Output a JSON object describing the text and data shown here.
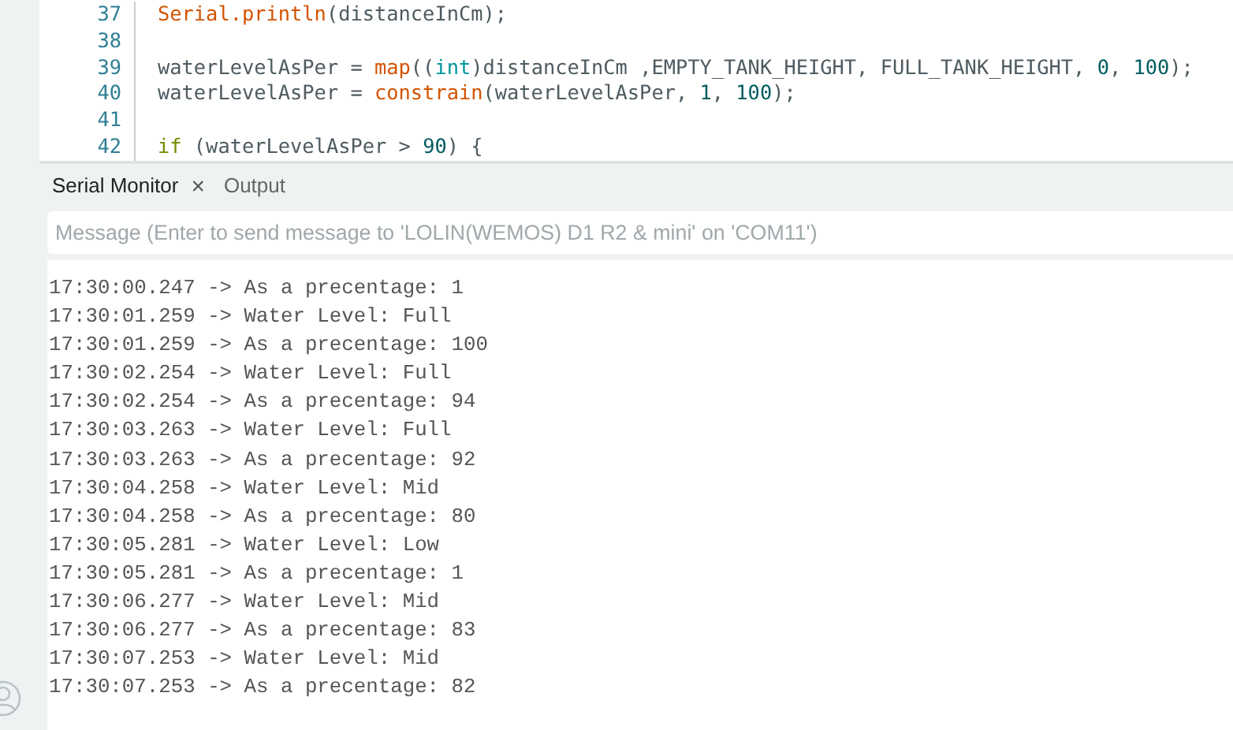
{
  "editor": {
    "lines": [
      {
        "number": "37",
        "tokens": [
          {
            "kind": "func",
            "text": "Serial.println"
          },
          {
            "kind": "plain",
            "text": "(distanceInCm);"
          }
        ]
      },
      {
        "number": "38"
      },
      {
        "number": "39",
        "tokens": [
          {
            "kind": "plain",
            "text": "waterLevelAsPer = "
          },
          {
            "kind": "func",
            "text": "map"
          },
          {
            "kind": "plain",
            "text": "(("
          },
          {
            "kind": "type",
            "text": "int"
          },
          {
            "kind": "plain",
            "text": ")distanceInCm ,EMPTY_TANK_HEIGHT, FULL_TANK_HEIGHT, "
          },
          {
            "kind": "number",
            "text": "0"
          },
          {
            "kind": "plain",
            "text": ", "
          },
          {
            "kind": "number",
            "text": "100"
          },
          {
            "kind": "plain",
            "text": ");"
          }
        ]
      },
      {
        "number": "40",
        "tokens": [
          {
            "kind": "plain",
            "text": "waterLevelAsPer = "
          },
          {
            "kind": "func",
            "text": "constrain"
          },
          {
            "kind": "plain",
            "text": "(waterLevelAsPer, "
          },
          {
            "kind": "number",
            "text": "1"
          },
          {
            "kind": "plain",
            "text": ", "
          },
          {
            "kind": "number",
            "text": "100"
          },
          {
            "kind": "plain",
            "text": ");"
          }
        ]
      },
      {
        "number": "41"
      },
      {
        "number": "42",
        "tokens": [
          {
            "kind": "keyword",
            "text": "if"
          },
          {
            "kind": "plain",
            "text": " (waterLevelAsPer > "
          },
          {
            "kind": "number",
            "text": "90"
          },
          {
            "kind": "plain",
            "text": ") {"
          }
        ]
      }
    ]
  },
  "panel": {
    "tabs": [
      {
        "label": "Serial Monitor",
        "selected": true,
        "closable": true
      },
      {
        "label": "Output",
        "selected": false,
        "closable": false
      }
    ],
    "close_glyph": "×",
    "message": {
      "placeholder": "Message (Enter to send message to 'LOLIN(WEMOS) D1 R2 & mini' on 'COM11')"
    },
    "output": [
      "17:30:00.247 -> As a precentage: 1",
      "17:30:01.259 -> Water Level: Full",
      "17:30:01.259 -> As a precentage: 100",
      "17:30:02.254 -> Water Level: Full",
      "17:30:02.254 -> As a precentage: 94",
      "17:30:03.263 -> Water Level: Full",
      "17:30:03.263 -> As a precentage: 92",
      "17:30:04.258 -> Water Level: Mid",
      "17:30:04.258 -> As a precentage: 80",
      "17:30:05.281 -> Water Level: Low",
      "17:30:05.281 -> As a precentage: 1",
      "17:30:06.277 -> Water Level: Mid",
      "17:30:06.277 -> As a precentage: 83",
      "17:30:07.253 -> Water Level: Mid",
      "17:30:07.253 -> As a precentage: 82"
    ]
  }
}
